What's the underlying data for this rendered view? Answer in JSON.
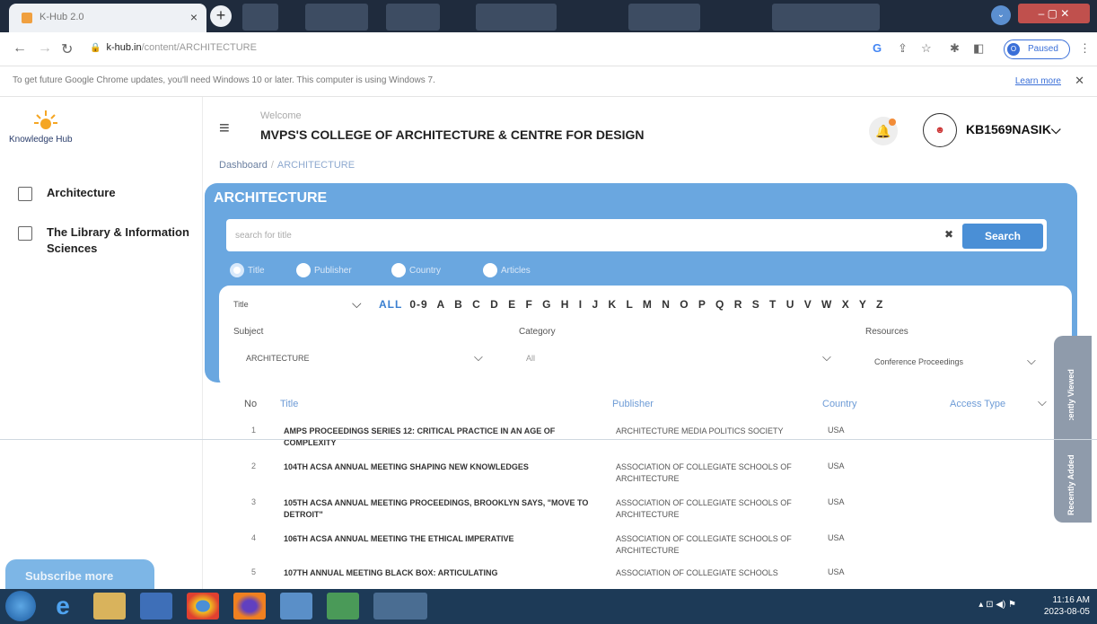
{
  "browser": {
    "tab_title": "K-Hub 2.0",
    "url_domain": "k-hub.in",
    "url_path": "/content/ARCHITECTURE",
    "profile_status": "Paused",
    "profile_initial": "O",
    "info_bar_text": "To get future Google Chrome updates, you'll need Windows 10 or later. This computer is using Windows 7.",
    "learn_more": "Learn more"
  },
  "sidebar": {
    "logo_text": "Knowledge Hub",
    "items": [
      {
        "label": "Architecture"
      },
      {
        "label": "The Library & Information Sciences"
      }
    ],
    "subscribe_label": "Subscribe more"
  },
  "header": {
    "welcome": "Welcome",
    "college": "MVPS'S COLLEGE OF ARCHITECTURE & CENTRE FOR DESIGN",
    "username": "KB1569NASIK"
  },
  "breadcrumb": {
    "root": "Dashboard",
    "separator": "/",
    "current": "ARCHITECTURE"
  },
  "panel": {
    "title": "ARCHITECTURE",
    "search_placeholder": "search for title",
    "search_button": "Search",
    "radios": [
      {
        "label": "Title",
        "selected": true
      },
      {
        "label": "Publisher",
        "selected": false
      },
      {
        "label": "Country",
        "selected": false
      },
      {
        "label": "Articles",
        "selected": false
      }
    ]
  },
  "filters": {
    "title_filter": "Title",
    "letters_all": "ALL",
    "letters": "0-9 A B C D E F G H I J K L M N O P Q R S T U V W X Y Z",
    "subject_label": "Subject",
    "subject_value": "ARCHITECTURE",
    "category_label": "Category",
    "category_value": "All",
    "resources_label": "Resources",
    "resources_value": "Conference Proceedings"
  },
  "side_tabs": {
    "recently_viewed": "Recently Viewed",
    "recently_added": "Recently Added"
  },
  "table": {
    "headers": {
      "no": "No",
      "title": "Title",
      "publisher": "Publisher",
      "country": "Country",
      "access": "Access Type"
    },
    "rows": [
      {
        "no": "1",
        "title": "AMPS PROCEEDINGS SERIES 12: CRITICAL PRACTICE IN AN AGE OF COMPLEXITY",
        "publisher": "ARCHITECTURE MEDIA POLITICS SOCIETY",
        "country": "USA"
      },
      {
        "no": "2",
        "title": "104TH ACSA ANNUAL MEETING SHAPING NEW KNOWLEDGES",
        "publisher": "ASSOCIATION OF COLLEGIATE SCHOOLS OF ARCHITECTURE",
        "country": "USA"
      },
      {
        "no": "3",
        "title": "105TH ACSA ANNUAL MEETING PROCEEDINGS, BROOKLYN SAYS, \"MOVE TO DETROIT\"",
        "publisher": "ASSOCIATION OF COLLEGIATE SCHOOLS OF ARCHITECTURE",
        "country": "USA"
      },
      {
        "no": "4",
        "title": "106TH ACSA ANNUAL MEETING THE ETHICAL IMPERATIVE",
        "publisher": "ASSOCIATION OF COLLEGIATE SCHOOLS OF ARCHITECTURE",
        "country": "USA"
      },
      {
        "no": "5",
        "title": "107TH ANNUAL MEETING BLACK BOX: ARTICULATING",
        "publisher": "ASSOCIATION OF COLLEGIATE SCHOOLS",
        "country": "USA"
      }
    ]
  },
  "taskbar": {
    "time": "11:16 AM",
    "date": "2023-08-05"
  },
  "colors": {
    "accent": "#6aa7e0",
    "button": "#4a8fd6",
    "taskbar": "#1d3a57"
  }
}
